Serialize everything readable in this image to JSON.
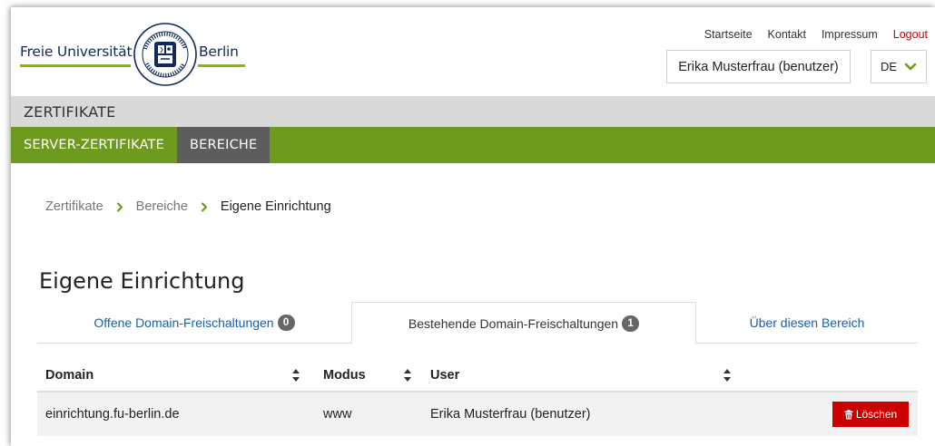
{
  "brand": {
    "left": "Freie Universität",
    "right": "Berlin",
    "seal_text_top": "VERITAS IUSTITIA LIBERTAS",
    "seal_text_bottom": "UNIVERSITÄT",
    "accent_green": "#86b800",
    "navy": "#0f2a5c"
  },
  "topnav": {
    "home": "Startseite",
    "contact": "Kontakt",
    "imprint": "Impressum",
    "logout": "Logout"
  },
  "user": {
    "name": "Erika Musterfrau (benutzer)"
  },
  "language": {
    "selected": "DE"
  },
  "app_title": "ZERTIFIKATE",
  "nav": {
    "items": [
      {
        "label": "SERVER-ZERTIFIKATE",
        "active": false
      },
      {
        "label": "BEREICHE",
        "active": true
      }
    ],
    "color": "#6e9b1e"
  },
  "breadcrumb": {
    "items": [
      "Zertifikate",
      "Bereiche"
    ],
    "current": "Eigene Einrichtung",
    "separator": "›"
  },
  "page_title": "Eigene Einrichtung",
  "tabs": [
    {
      "label": "Offene Domain-Freischaltungen",
      "count": "0",
      "active": false
    },
    {
      "label": "Bestehende Domain-Freischaltungen",
      "count": "1",
      "active": true
    },
    {
      "label": "Über diesen Bereich",
      "active": false
    }
  ],
  "table": {
    "columns": [
      "Domain",
      "Modus",
      "User",
      ""
    ],
    "rows": [
      {
        "domain": "einrichtung.fu-berlin.de",
        "mode": "www",
        "user": "Erika Musterfrau (benutzer)",
        "action": "Löschen"
      }
    ]
  },
  "icons": {
    "sort": "sort-icon",
    "trash": "trash-icon",
    "chevron": "chevron-down-icon",
    "breadcrumb_sep": "chevron-right-icon"
  }
}
